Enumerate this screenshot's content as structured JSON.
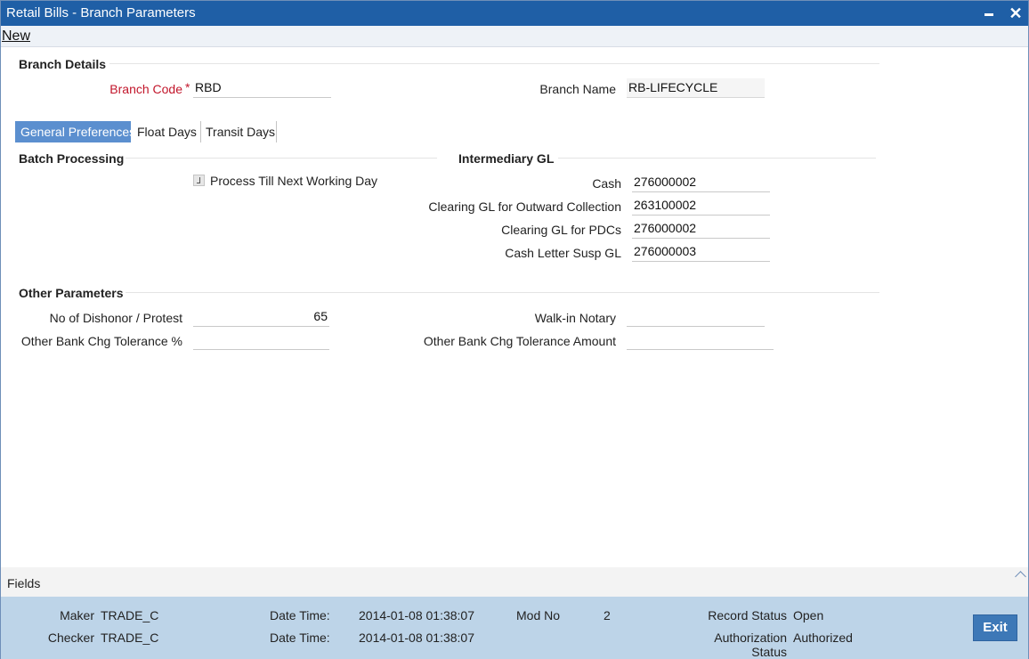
{
  "window": {
    "title": "Retail Bills - Branch Parameters"
  },
  "menu": {
    "new_label": "New"
  },
  "branch_details": {
    "section_title": "Branch Details",
    "branch_code_label": "Branch Code",
    "required_mark": "*",
    "branch_code_value": "RBD",
    "branch_name_label": "Branch Name",
    "branch_name_value": "RB-LIFECYCLE"
  },
  "tabs": [
    {
      "label": "General Preferences",
      "active": true
    },
    {
      "label": "Float Days",
      "active": false
    },
    {
      "label": "Transit Days",
      "active": false
    }
  ],
  "batch_processing": {
    "section_title": "Batch Processing",
    "process_till_label": "Process Till Next Working Day",
    "process_till_checked": false
  },
  "intermediary_gl": {
    "section_title": "Intermediary GL",
    "cash_label": "Cash",
    "cash_value": "276000002",
    "outward_label": "Clearing GL for Outward Collection",
    "outward_value": "263100002",
    "pdc_label": "Clearing GL for PDCs",
    "pdc_value": "276000002",
    "cash_letter_label": "Cash Letter Susp GL",
    "cash_letter_value": "276000003"
  },
  "other_parameters": {
    "section_title": "Other Parameters",
    "dishonor_label": "No of Dishonor / Protest",
    "dishonor_value": "65",
    "tolerance_pct_label": "Other Bank Chg Tolerance %",
    "tolerance_pct_value": "",
    "walkin_label": "Walk-in Notary",
    "walkin_value": "",
    "tolerance_amt_label": "Other Bank Chg Tolerance Amount",
    "tolerance_amt_value": ""
  },
  "fields_bar": {
    "label": "Fields"
  },
  "audit": {
    "maker_label": "Maker",
    "maker_value": "TRADE_C",
    "checker_label": "Checker",
    "checker_value": "TRADE_C",
    "datetime_label": "Date Time:",
    "maker_datetime": "2014-01-08 01:38:07",
    "checker_datetime": "2014-01-08 01:38:07",
    "mod_no_label": "Mod No",
    "mod_no_value": "2",
    "record_status_label": "Record Status",
    "record_status_value": "Open",
    "auth_status_label_1": "Authorization",
    "auth_status_label_2": "Status",
    "auth_status_value": "Authorized",
    "exit_label": "Exit"
  },
  "colors": {
    "titlebar": "#1f5fa6",
    "active_tab": "#5b8fcf",
    "required": "#c2162b",
    "footer": "#bdd4e8",
    "exit_button": "#3d78b7"
  }
}
